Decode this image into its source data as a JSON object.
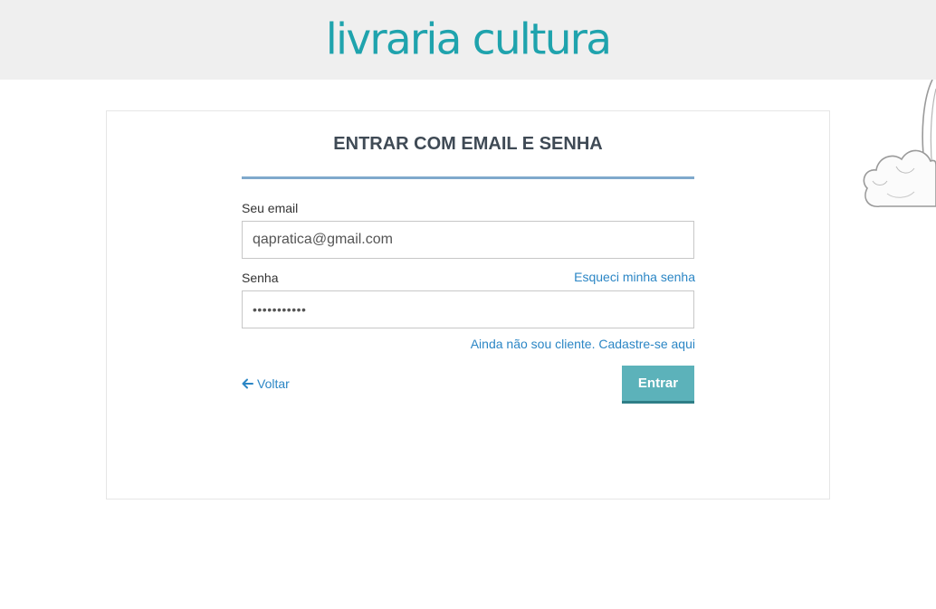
{
  "header": {
    "logo_text": "livraria cultura",
    "brand_color": "#1fa3ad"
  },
  "form": {
    "title": "ENTRAR COM EMAIL E SENHA",
    "email_label": "Seu email",
    "email_value": "qapratica@gmail.com",
    "password_label": "Senha",
    "password_value": "•••••••••••",
    "forgot_link": "Esqueci minha senha",
    "register_link": "Ainda não sou cliente. Cadastre-se aqui",
    "back_label": "Voltar",
    "submit_label": "Entrar",
    "link_color": "#2b86c5",
    "button_color": "#5cb2ba"
  }
}
